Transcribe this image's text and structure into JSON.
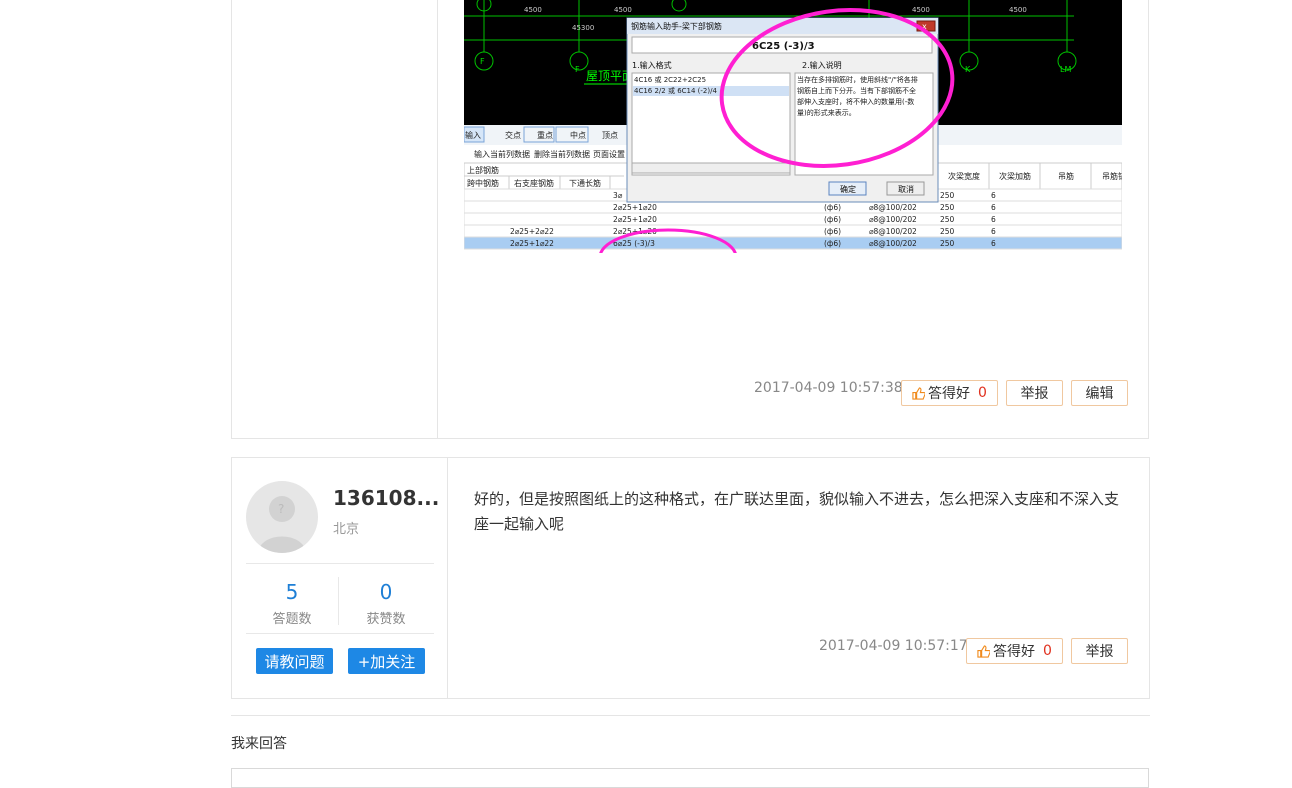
{
  "post1": {
    "timestamp": "2017-04-09 10:57:38",
    "like_label": "答得好",
    "like_count": "0",
    "report_label": "举报",
    "edit_label": "编辑"
  },
  "screenshot": {
    "dialog_title": "钢筋输入助手-梁下部钢筋",
    "dialog_value": "6C25 (-3)/3",
    "format_label": "1.输入格式",
    "format_line1": "4C16 或 2C22+2C25",
    "format_line2": "4C16 2/2 或 6C14 (-2)/4",
    "desc_label": "2.输入说明",
    "desc_text": [
      "当存在多排钢筋时，使用斜线\"/\"将各排",
      "钢筋自上而下分开。当有下部钢筋不全",
      "部伸入支座时，将不伸入的数量用(-数",
      "量)的形式来表示。"
    ],
    "ok_label": "确定",
    "cancel_label": "取消",
    "plan_label": "屋顶平面",
    "dims": [
      "4500",
      "4500",
      "4500",
      "4500",
      "45300"
    ],
    "axis_labels": [
      "F",
      "F",
      "K",
      "LM"
    ],
    "toolbar": [
      "输入",
      "交点",
      "重点",
      "中点",
      "顶点"
    ],
    "menu": [
      "输入当前列数据",
      "删除当前列数据",
      "页面设置"
    ],
    "col_group": "上部钢筋",
    "cols": [
      "跨中钢筋",
      "右支座钢筋",
      "下通长筋"
    ],
    "right_cols": [
      "次梁宽度",
      "次梁加筋",
      "吊筋",
      "吊筋锚"
    ],
    "rows": [
      {
        "a": "",
        "b": "3⌀",
        "c": "",
        "d": "",
        "e": "250",
        "f": "6"
      },
      {
        "a": "",
        "b": "2⌀25+1⌀20",
        "c": "(ф6)",
        "d": "⌀8@100/20",
        "n": "2",
        "e": "250",
        "f": "6"
      },
      {
        "a": "",
        "b": "2⌀25+1⌀20",
        "c": "(ф6)",
        "d": "⌀8@100/20",
        "n": "2",
        "e": "250",
        "f": "6"
      },
      {
        "a": "2⌀25+2⌀22",
        "b": "2⌀25+1⌀20",
        "c": "(ф6)",
        "d": "⌀8@100/20",
        "n": "2",
        "e": "250",
        "f": "6"
      },
      {
        "a": "2⌀25+1⌀22",
        "b": "6⌀25 (-3)/3",
        "c": "(ф6)",
        "d": "⌀8@100/20",
        "n": "2",
        "e": "250",
        "f": "6"
      }
    ]
  },
  "post2": {
    "username": "136108...",
    "city": "北京",
    "answers_count": "5",
    "answers_label": "答题数",
    "likes_count": "0",
    "likes_label": "获赞数",
    "ask_button": "请教问题",
    "follow_button": "+加关注",
    "content": "好的，但是按照图纸上的这种格式，在广联达里面，貌似输入不进去，怎么把深入支座和不深入支座一起输入呢",
    "timestamp": "2017-04-09 10:57:17",
    "like_label": "答得好",
    "like_count": "0",
    "report_label": "举报"
  },
  "answer_section": {
    "label": "我来回答"
  },
  "colors": {
    "accent_blue": "#1e88e5",
    "count_red": "#e0301e",
    "highlight_magenta": "#ff1fd2",
    "cad_green": "#00ff00"
  }
}
